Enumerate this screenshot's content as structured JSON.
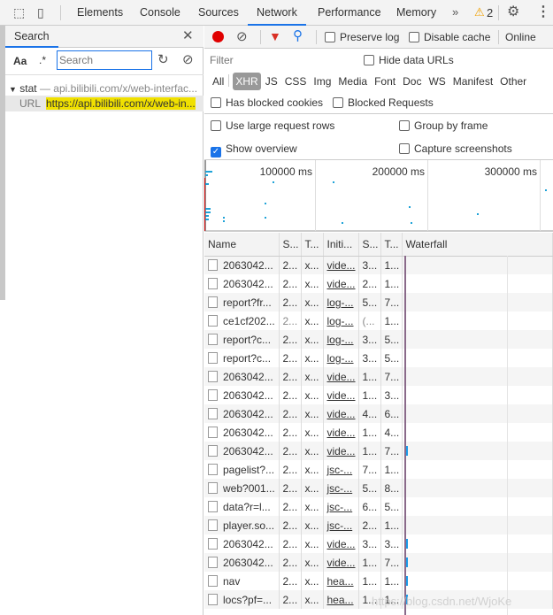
{
  "devtools_tabs": [
    "Elements",
    "Console",
    "Sources",
    "Network",
    "Performance",
    "Memory"
  ],
  "active_tab": "Network",
  "warning_count": "2",
  "search_panel": {
    "title": "Search",
    "case_label": "Aa",
    "regex_label": ".*",
    "placeholder": "Search",
    "result_group": {
      "name": "stat",
      "separator": "—",
      "url": "api.bilibili.com/x/web-interfac..."
    },
    "result_line": {
      "label": "URL",
      "match": "https://api.bilibili.com/x/web-in..."
    }
  },
  "toolbar": {
    "preserve_log": "Preserve log",
    "disable_cache": "Disable cache",
    "throttling": "Online",
    "preserve_checked": false,
    "disable_checked": false
  },
  "filter": {
    "placeholder": "Filter",
    "hide_data_urls": "Hide data URLs",
    "types": [
      "All",
      "XHR",
      "JS",
      "CSS",
      "Img",
      "Media",
      "Font",
      "Doc",
      "WS",
      "Manifest",
      "Other"
    ],
    "active_type": "XHR",
    "blocked_cookies": "Has blocked cookies",
    "blocked_requests": "Blocked Requests"
  },
  "options": {
    "large_rows": "Use large request rows",
    "group_by_frame": "Group by frame",
    "show_overview": "Show overview",
    "capture_screenshots": "Capture screenshots",
    "show_overview_checked": true
  },
  "overview": {
    "ticks": [
      "100000 ms",
      "200000 ms",
      "300000 ms"
    ]
  },
  "columns": [
    "Name",
    "S...",
    "T...",
    "Initi...",
    "S...",
    "T...",
    "Waterfall"
  ],
  "rows": [
    [
      "2063042...",
      "2...",
      "x...",
      "vide...",
      "3...",
      "1..."
    ],
    [
      "2063042...",
      "2...",
      "x...",
      "vide...",
      "2...",
      "1..."
    ],
    [
      "report?fr...",
      "2...",
      "x...",
      "log-...",
      "5...",
      "7..."
    ],
    [
      "ce1cf202...",
      "2...",
      "x...",
      "log-...",
      "(...",
      "1..."
    ],
    [
      "report?c...",
      "2...",
      "x...",
      "log-...",
      "3...",
      "5..."
    ],
    [
      "report?c...",
      "2...",
      "x...",
      "log-...",
      "3...",
      "5..."
    ],
    [
      "2063042...",
      "2...",
      "x...",
      "vide...",
      "1...",
      "7..."
    ],
    [
      "2063042...",
      "2...",
      "x...",
      "vide...",
      "1...",
      "3..."
    ],
    [
      "2063042...",
      "2...",
      "x...",
      "vide...",
      "4...",
      "6..."
    ],
    [
      "2063042...",
      "2...",
      "x...",
      "vide...",
      "1...",
      "4..."
    ],
    [
      "2063042...",
      "2...",
      "x...",
      "vide...",
      "1...",
      "7..."
    ],
    [
      "pagelist?...",
      "2...",
      "x...",
      "jsc-...",
      "7...",
      "1..."
    ],
    [
      "web?001...",
      "2...",
      "x...",
      "jsc-...",
      "5...",
      "8..."
    ],
    [
      "data?r=l...",
      "2...",
      "x...",
      "jsc-...",
      "6...",
      "5..."
    ],
    [
      "player.so...",
      "2...",
      "x...",
      "jsc-...",
      "2...",
      "1..."
    ],
    [
      "2063042...",
      "2...",
      "x...",
      "vide...",
      "3...",
      "3..."
    ],
    [
      "2063042...",
      "2...",
      "x...",
      "vide...",
      "1...",
      "7..."
    ],
    [
      "nav",
      "2...",
      "x...",
      "hea...",
      "1...",
      "1..."
    ],
    [
      "locs?pf=...",
      "2...",
      "x...",
      "hea...",
      "1...",
      "1..."
    ]
  ],
  "watermark": "https://blog.csdn.net/WjoKe",
  "colors": {
    "accent": "#1a73e8",
    "record": "#e00000",
    "filter_active": "#d93025",
    "highlight": "#f0e000"
  }
}
